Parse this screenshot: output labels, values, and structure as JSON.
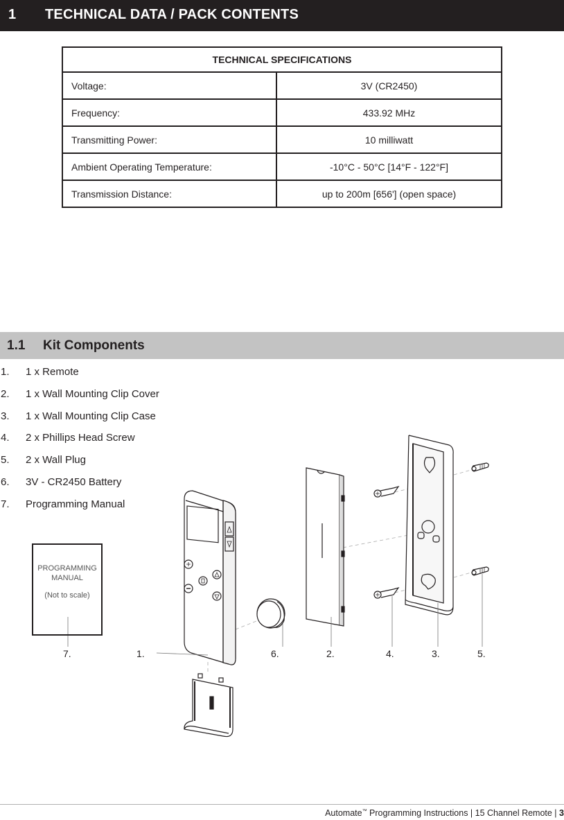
{
  "section": {
    "number": "1",
    "title": "TECHNICAL DATA / PACK CONTENTS"
  },
  "specs": {
    "header": "TECHNICAL SPECIFICATIONS",
    "rows": [
      {
        "label": "Voltage:",
        "value": "3V (CR2450)"
      },
      {
        "label": "Frequency:",
        "value": "433.92 MHz"
      },
      {
        "label": "Transmitting Power:",
        "value": "10 milliwatt"
      },
      {
        "label": "Ambient Operating Temperature:",
        "value": "-10°C - 50°C [14°F - 122°F]"
      },
      {
        "label": "Transmission Distance:",
        "value": "up to 200m [656'] (open space)"
      }
    ]
  },
  "subsection": {
    "number": "1.1",
    "title": "Kit Components"
  },
  "kit_items": [
    {
      "number": "1.",
      "text": "1 x Remote"
    },
    {
      "number": "2.",
      "text": "1 x Wall Mounting Clip Cover"
    },
    {
      "number": "3.",
      "text": "1 x Wall Mounting Clip Case"
    },
    {
      "number": "4.",
      "text": "2 x Phillips Head Screw"
    },
    {
      "number": "5.",
      "text": "2 x Wall Plug"
    },
    {
      "number": "6.",
      "text": "3V - CR2450 Battery"
    },
    {
      "number": "7.",
      "text": "Programming Manual"
    }
  ],
  "diagram": {
    "manual_box": {
      "line1": "PROGRAMMING",
      "line2": "MANUAL",
      "note": "(Not to scale)"
    },
    "callouts": [
      "7.",
      "1.",
      "6.",
      "2.",
      "4.",
      "3.",
      "5."
    ],
    "icons": [
      "remote-icon",
      "battery-cover-icon",
      "coin-battery-icon",
      "clip-cover-icon",
      "screw-icon",
      "clip-case-icon",
      "wall-plug-icon"
    ]
  },
  "footer": {
    "brand": "Automate",
    "trademark": "™",
    "text": " Programming Instructions | 15 Channel Remote | ",
    "page": "3"
  }
}
